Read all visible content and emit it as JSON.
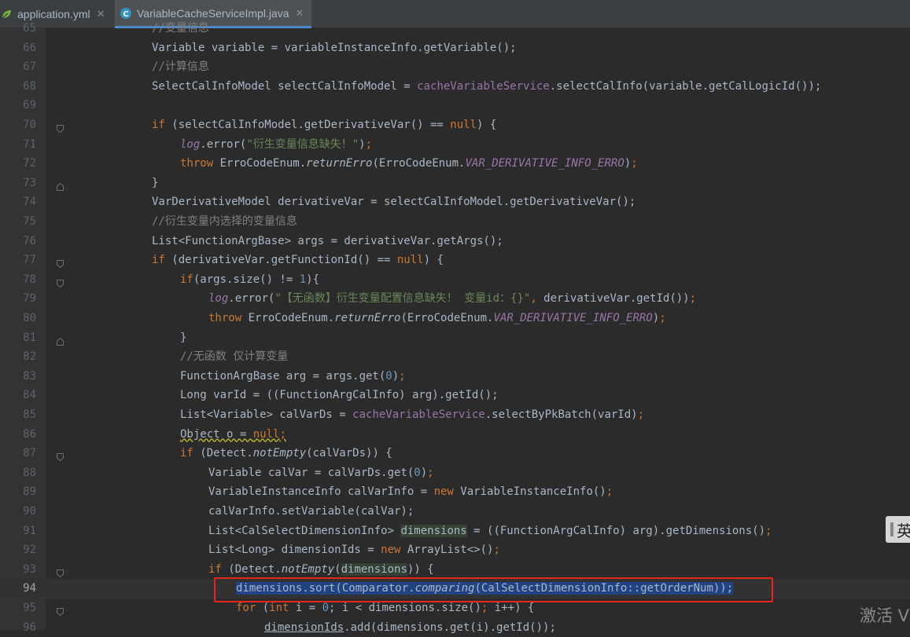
{
  "tabs": [
    {
      "label": "application.yml",
      "close": "✕",
      "icon": "yaml-leaf-icon",
      "active": false
    },
    {
      "label": "VariableCacheServiceImpl.java",
      "close": "✕",
      "icon": "java-class-icon",
      "active": true
    }
  ],
  "colors": {
    "background": "#2b2b2b",
    "keyword": "#cc7832",
    "string": "#6a8759",
    "number": "#6897bb",
    "field": "#9876aa",
    "comment": "#808080",
    "selection": "#214283",
    "highlight_box": "#e8241c"
  },
  "editor": {
    "lines": [
      {
        "n": "65",
        "text": "//变量信息"
      },
      {
        "n": "66",
        "text": "Variable variable = variableInstanceInfo.getVariable();"
      },
      {
        "n": "67",
        "text": "//计算信息"
      },
      {
        "n": "68",
        "text": "SelectCalInfoModel selectCalInfoModel = cacheVariableService.selectCalInfo(variable.getCalLogicId());"
      },
      {
        "n": "69",
        "text": ""
      },
      {
        "n": "70",
        "text": "if (selectCalInfoModel.getDerivativeVar() == null) {"
      },
      {
        "n": "71",
        "text": "log.error(\"衍生变量信息缺失！\");"
      },
      {
        "n": "72",
        "text": "throw ErroCodeEnum.returnErro(ErroCodeEnum.VAR_DERIVATIVE_INFO_ERRO);"
      },
      {
        "n": "73",
        "text": "}"
      },
      {
        "n": "74",
        "text": "VarDerivativeModel derivativeVar = selectCalInfoModel.getDerivativeVar();"
      },
      {
        "n": "75",
        "text": "//衍生变量内选择的变量信息"
      },
      {
        "n": "76",
        "text": "List<FunctionArgBase> args = derivativeVar.getArgs();"
      },
      {
        "n": "77",
        "text": "if (derivativeVar.getFunctionId() == null) {"
      },
      {
        "n": "78",
        "text": "if(args.size() != 1){"
      },
      {
        "n": "79",
        "text": "log.error(\"【无函数】衍生变量配置信息缺失！ 变量id：{}\", derivativeVar.getId());"
      },
      {
        "n": "80",
        "text": "throw ErroCodeEnum.returnErro(ErroCodeEnum.VAR_DERIVATIVE_INFO_ERRO);"
      },
      {
        "n": "81",
        "text": "}"
      },
      {
        "n": "82",
        "text": "//无函数 仅计算变量"
      },
      {
        "n": "83",
        "text": "FunctionArgBase arg = args.get(0);"
      },
      {
        "n": "84",
        "text": "Long varId = ((FunctionArgCalInfo) arg).getId();"
      },
      {
        "n": "85",
        "text": "List<Variable> calVarDs = cacheVariableService.selectByPkBatch(varId);"
      },
      {
        "n": "86",
        "text": "Object o = null;"
      },
      {
        "n": "87",
        "text": "if (Detect.notEmpty(calVarDs)) {"
      },
      {
        "n": "88",
        "text": "Variable calVar = calVarDs.get(0);"
      },
      {
        "n": "89",
        "text": "VariableInstanceInfo calVarInfo = new VariableInstanceInfo();"
      },
      {
        "n": "90",
        "text": "calVarInfo.setVariable(calVar);"
      },
      {
        "n": "91",
        "text": "List<CalSelectDimensionInfo> dimensions = ((FunctionArgCalInfo) arg).getDimensions();"
      },
      {
        "n": "92",
        "text": "List<Long> dimensionIds = new ArrayList<>();"
      },
      {
        "n": "93",
        "text": "if (Detect.notEmpty(dimensions)) {"
      },
      {
        "n": "94",
        "text": "dimensions.sort(Comparator.comparing(CalSelectDimensionInfo::getOrderNum));"
      },
      {
        "n": "95",
        "text": "for (int i = 0; i < dimensions.size(); i++) {"
      },
      {
        "n": "96",
        "text": "dimensionIds.add(dimensions.get(i).getId());"
      }
    ]
  },
  "watermark": {
    "text": "激活 V"
  },
  "side_widget": {
    "text": "英"
  }
}
